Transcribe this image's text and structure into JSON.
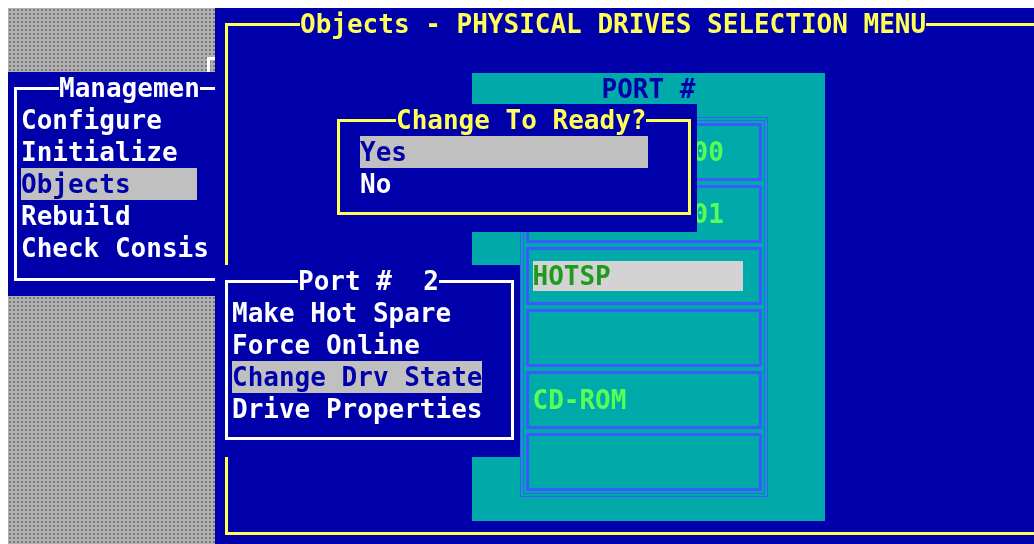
{
  "main_window": {
    "title": "Objects - PHYSICAL DRIVES SELECTION MENU"
  },
  "management_menu": {
    "title": "Managemen",
    "items": [
      {
        "label": "Configure",
        "selected": false
      },
      {
        "label": "Initialize",
        "selected": false
      },
      {
        "label": "Objects",
        "selected": true
      },
      {
        "label": "Rebuild",
        "selected": false
      },
      {
        "label": "Check Consis",
        "selected": false
      }
    ]
  },
  "port_list": {
    "header": "PORT #",
    "drives": [
      {
        "label": "00",
        "kind": "covered",
        "selected": false
      },
      {
        "label": "01",
        "kind": "covered",
        "selected": false
      },
      {
        "label": "HOTSP",
        "kind": "plain",
        "selected": true
      },
      {
        "kind": "plain",
        "selected": false
      },
      {
        "label": "CD-ROM",
        "kind": "plain",
        "selected": false
      },
      {
        "kind": "plain",
        "selected": false
      }
    ]
  },
  "port_menu": {
    "title": "Port #  2",
    "items": [
      {
        "label": "Make Hot Spare",
        "selected": false
      },
      {
        "label": "Force Online",
        "selected": false
      },
      {
        "label": "Change Drv State",
        "selected": true
      },
      {
        "label": "Drive Properties",
        "selected": false
      }
    ]
  },
  "confirm_dialog": {
    "title": "Change To Ready?",
    "options": [
      {
        "label": "Yes",
        "selected": true
      },
      {
        "label": "No",
        "selected": false
      }
    ]
  }
}
